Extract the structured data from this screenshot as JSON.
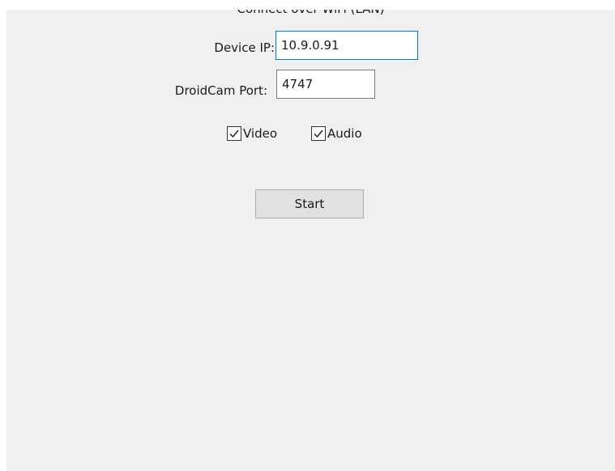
{
  "section": {
    "title": "Connect over WiFi (LAN)"
  },
  "form": {
    "device_ip_label": "Device IP:",
    "device_ip_value": "10.9.0.91",
    "port_label": "DroidCam Port:",
    "port_value": "4747"
  },
  "options": {
    "video_label": "Video",
    "video_checked": true,
    "audio_label": "Audio",
    "audio_checked": true
  },
  "actions": {
    "start_label": "Start"
  },
  "icons": {
    "checkmark": "checkmark-icon"
  },
  "colors": {
    "window_bg": "#f0f0f0",
    "focus_border": "#0078d7",
    "button_bg": "#e1e1e1"
  }
}
